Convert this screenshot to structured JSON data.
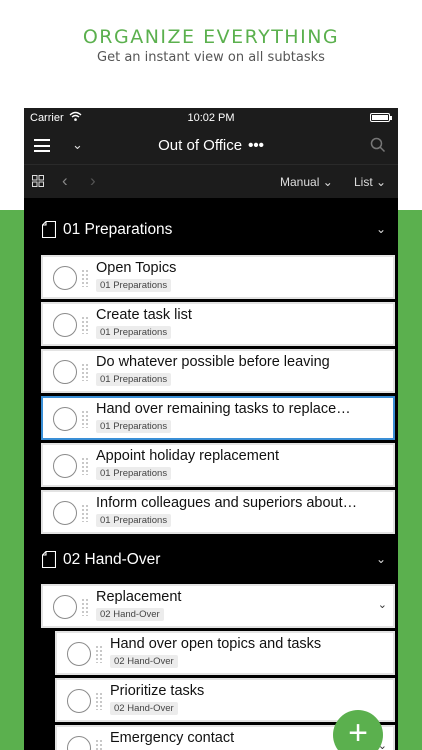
{
  "promo": {
    "title": "ORGANIZE EVERYTHING",
    "subtitle": "Get an instant view on all subtasks"
  },
  "status_bar": {
    "carrier": "Carrier",
    "time": "10:02 PM"
  },
  "nav": {
    "title": "Out of Office",
    "more": "•••"
  },
  "toolbar": {
    "sort_label": "Manual",
    "view_label": "List"
  },
  "sections": [
    {
      "label": "01 Preparations",
      "tasks": [
        {
          "name": "Open Topics",
          "tag": "01 Preparations"
        },
        {
          "name": "Create task list",
          "tag": "01 Preparations"
        },
        {
          "name": "Do whatever possible before leaving",
          "tag": "01 Preparations"
        },
        {
          "name": "Hand over remaining tasks to replace…",
          "tag": "01 Preparations"
        },
        {
          "name": "Appoint holiday replacement",
          "tag": "01 Preparations"
        },
        {
          "name": "Inform colleagues and superiors about…",
          "tag": "01 Preparations"
        }
      ]
    },
    {
      "label": "02 Hand-Over",
      "tasks": [
        {
          "name": "Replacement",
          "tag": "02 Hand-Over"
        },
        {
          "name": "Hand over open topics and tasks",
          "tag": "02 Hand-Over"
        },
        {
          "name": "Prioritize tasks",
          "tag": "02 Hand-Over"
        },
        {
          "name": "Emergency contact",
          "tag": ""
        }
      ]
    }
  ],
  "fab_label": "+",
  "colors": {
    "accent": "#5bb04e",
    "selected_border": "#3a8fd6",
    "header_bg": "#1c1c1c"
  }
}
